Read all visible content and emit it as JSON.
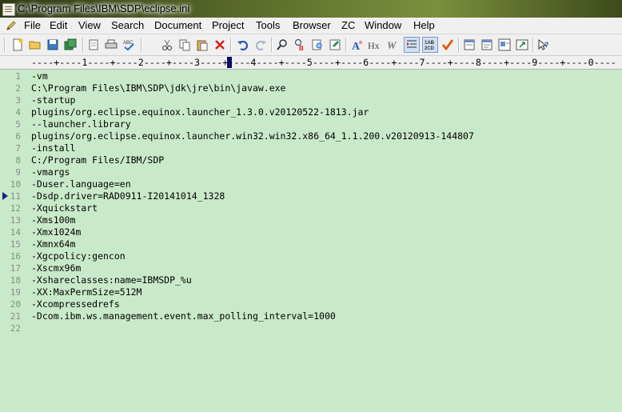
{
  "window": {
    "title": "C:\\Program Files\\IBM\\SDP\\eclipse.ini"
  },
  "menu": [
    "File",
    "Edit",
    "View",
    "Search",
    "Document",
    "Project",
    "Tools",
    "Browser",
    "ZC",
    "Window",
    "Help"
  ],
  "ruler": {
    "text": "----+----1----+----2----+----3----+----4----+----5----+----6----+----7----+----8----+----9----+----0----"
  },
  "editor": {
    "current_line": 11,
    "lines": [
      "-vm",
      "C:\\Program Files\\IBM\\SDP\\jdk\\jre\\bin\\javaw.exe",
      "-startup",
      "plugins/org.eclipse.equinox.launcher_1.3.0.v20120522-1813.jar",
      "--launcher.library",
      "plugins/org.eclipse.equinox.launcher.win32.win32.x86_64_1.1.200.v20120913-144807",
      "-install",
      "C:/Program Files/IBM/SDP",
      "-vmargs",
      "-Duser.language=en",
      "-Dsdp.driver=RAD0911-I20141014_1328",
      "-Xquickstart",
      "-Xms100m",
      "-Xmx1024m",
      "-Xmnx64m",
      "-Xgcpolicy:gencon",
      "-Xscmx96m",
      "-Xshareclasses:name=IBMSDP_%u",
      "-XX:MaxPermSize=512M",
      "-Xcompressedrefs",
      "-Dcom.ibm.ws.management.event.max_polling_interval=1000",
      ""
    ],
    "line_numbers": [
      "1",
      "2",
      "3",
      "4",
      "5",
      "6",
      "7",
      "8",
      "9",
      "10",
      "11",
      "12",
      "13",
      "14",
      "15",
      "16",
      "17",
      "18",
      "19",
      "20",
      "21",
      "22"
    ]
  },
  "toolbar_icons": [
    "new-file-icon",
    "open-folder-icon",
    "save-icon",
    "save-all-icon",
    "print-preview-icon",
    "print-icon",
    "spellcheck-icon",
    "cut-icon",
    "copy-icon",
    "paste-icon",
    "delete-icon",
    "undo-icon",
    "redo-icon",
    "find-icon",
    "replace-icon",
    "find-in-files-icon",
    "clear-icon",
    "font-icon",
    "hex-icon",
    "word-wrap-icon",
    "indent-icon",
    "sort-icon",
    "checkmark-icon",
    "window-icon",
    "browser-icon",
    "tile-icon",
    "cascade-icon",
    "help-icon"
  ]
}
